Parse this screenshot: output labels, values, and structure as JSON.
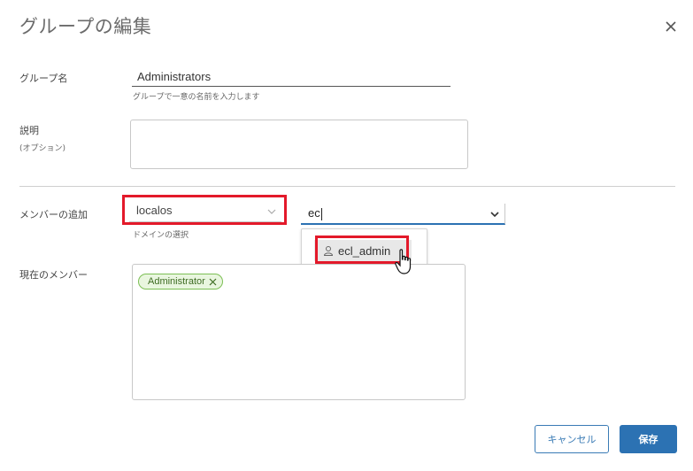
{
  "dialog": {
    "title": "グループの編集",
    "close_icon": "close-icon"
  },
  "group_name": {
    "label": "グループ名",
    "value": "Administrators",
    "hint": "グループで一意の名前を入力します"
  },
  "description": {
    "label": "説明",
    "sublabel": "(オプション)",
    "value": ""
  },
  "add_members": {
    "label": "メンバーの追加",
    "domain_select": {
      "value": "localos",
      "hint": "ドメインの選択"
    },
    "search": {
      "value": "ec"
    },
    "suggestions": [
      {
        "label": "ecl_admin",
        "icon": "user-icon"
      }
    ]
  },
  "current_members": {
    "label": "現在のメンバー",
    "chips": [
      {
        "label": "Administrator",
        "remove_icon": "close-icon"
      }
    ]
  },
  "footer": {
    "cancel_label": "キャンセル",
    "save_label": "保存"
  },
  "colors": {
    "highlight": "#e3192a",
    "primary": "#2c72b3",
    "chip_border": "#7cbf54",
    "chip_bg": "#e9f6df"
  }
}
